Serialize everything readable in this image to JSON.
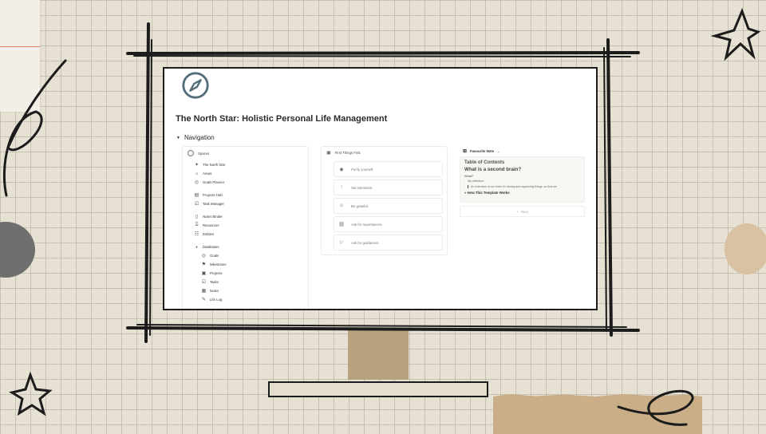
{
  "page": {
    "title": "The North Star: Holistic Personal Life Management",
    "navigation_label": "Navigation",
    "accent_color": "#546e7a"
  },
  "spaces": {
    "header": "Spaces",
    "items": [
      {
        "label": "The North Star",
        "icon": "compass-icon"
      },
      {
        "label": "Areas",
        "icon": "home-icon"
      },
      {
        "label": "Goals Planner",
        "icon": "target-icon"
      },
      {
        "label": "Projects Hub",
        "icon": "board-icon"
      },
      {
        "label": "Task Manager",
        "icon": "checklist-icon"
      },
      {
        "label": "Notes Binder",
        "icon": "notebook-icon"
      },
      {
        "label": "Resources",
        "icon": "bank-icon"
      },
      {
        "label": "Entities",
        "icon": "people-icon"
      }
    ],
    "databases": {
      "label": "Databases",
      "items": [
        {
          "label": "Goals",
          "icon": "target-icon"
        },
        {
          "label": "Milestones",
          "icon": "flag-icon"
        },
        {
          "label": "Projects",
          "icon": "folder-icon"
        },
        {
          "label": "Tasks",
          "icon": "checkbox-icon"
        },
        {
          "label": "Notes",
          "icon": "note-icon"
        },
        {
          "label": "Life Log",
          "icon": "pencil-icon"
        }
      ]
    }
  },
  "first_things": {
    "header": "First Things First",
    "items": [
      {
        "label": "Purify yourself.",
        "icon": "sparkle-icon"
      },
      {
        "label": "Set intentions.",
        "icon": "arrow-up-icon"
      },
      {
        "label": "Be grateful.",
        "icon": "smile-icon"
      },
      {
        "label": "Ask for repentances.",
        "icon": "link-icon"
      },
      {
        "label": "Ask for guidances.",
        "icon": "signpost-icon"
      }
    ]
  },
  "favourite": {
    "header": "Favourite Note",
    "toc": "Table of Contents",
    "question": "What is a second brain?",
    "what": "What?",
    "definition": "My definition:",
    "quote": "An extension of our brain for storing and organizing things, so that we",
    "how": "How This Template Works",
    "new_label": "New"
  }
}
